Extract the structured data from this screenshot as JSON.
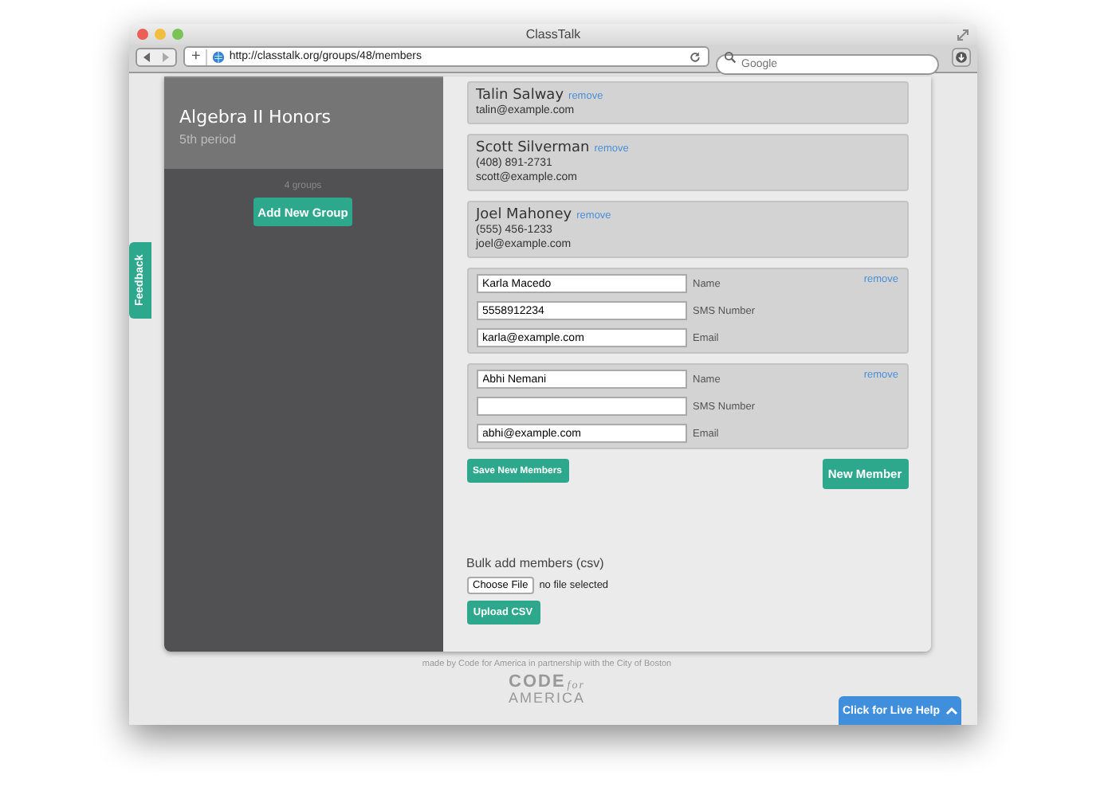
{
  "window": {
    "title": "ClassTalk"
  },
  "toolbar": {
    "url": "http://classtalk.org/groups/48/members",
    "search_placeholder": "Google",
    "new_tab": "+"
  },
  "feedback": {
    "label": "Feedback"
  },
  "sidebar": {
    "group_title": "Algebra II Honors",
    "group_subtitle": "5th period",
    "group_count": "4 groups",
    "add_button": "Add New Group"
  },
  "members": [
    {
      "name": "Talin Salway",
      "remove": "remove",
      "email": "talin@example.com"
    },
    {
      "name": "Scott Silverman",
      "remove": "remove",
      "phone": "(408) 891-2731",
      "email": "scott@example.com"
    },
    {
      "name": "Joel Mahoney",
      "remove": "remove",
      "phone": "(555) 456-1233",
      "email": "joel@example.com"
    }
  ],
  "new_members": [
    {
      "remove": "remove",
      "fields": [
        {
          "value": "Karla Macedo",
          "label": "Name"
        },
        {
          "value": "5558912234",
          "label": "SMS Number"
        },
        {
          "value": "karla@example.com",
          "label": "Email"
        }
      ]
    },
    {
      "remove": "remove",
      "fields": [
        {
          "value": "Abhi Nemani",
          "label": "Name"
        },
        {
          "label": "SMS Number"
        },
        {
          "value": "abhi@example.com",
          "label": "Email"
        }
      ]
    }
  ],
  "save_button": "Save New Members",
  "new_member_button": "New Member",
  "bulk": {
    "label": "Bulk add members (csv)",
    "choose_button": "Choose File",
    "file_status": "no file selected",
    "upload_button": "Upload CSV"
  },
  "footer": {
    "text": "made by Code for America in partnership with the City of Boston",
    "logo_top": "CODE",
    "logo_for": "for",
    "logo_bottom": "AMERICA"
  },
  "live_help": {
    "label": "Click for Live Help"
  }
}
